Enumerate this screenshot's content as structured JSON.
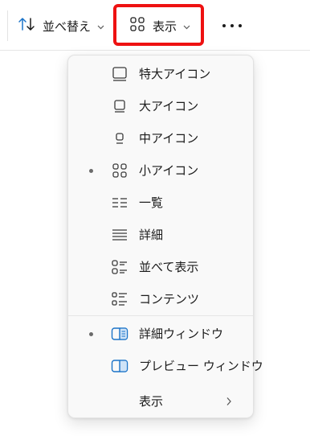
{
  "toolbar": {
    "sort_label": "並べ替え",
    "view_label": "表示",
    "more_icon": "more-horizontal-icon"
  },
  "menu": {
    "items": [
      {
        "label": "特大アイコン",
        "icon": "extra-large-icons-icon",
        "selected": false
      },
      {
        "label": "大アイコン",
        "icon": "large-icons-icon",
        "selected": false
      },
      {
        "label": "中アイコン",
        "icon": "medium-icons-icon",
        "selected": false
      },
      {
        "label": "小アイコン",
        "icon": "small-icons-icon",
        "selected": true
      },
      {
        "label": "一覧",
        "icon": "list-icon",
        "selected": false
      },
      {
        "label": "詳細",
        "icon": "details-icon",
        "selected": false
      },
      {
        "label": "並べて表示",
        "icon": "tiles-icon",
        "selected": false
      },
      {
        "label": "コンテンツ",
        "icon": "content-icon",
        "selected": false
      }
    ],
    "panes": [
      {
        "label": "詳細ウィンドウ",
        "icon": "details-pane-icon",
        "selected": true
      },
      {
        "label": "プレビュー ウィンドウ",
        "icon": "preview-pane-icon",
        "selected": false
      }
    ],
    "show": {
      "label": "表示",
      "icon": "chevron-right-icon"
    }
  },
  "colors": {
    "highlight": "#ee1111",
    "accent": "#1a73c8",
    "menu_bg": "#f9f9f9"
  }
}
